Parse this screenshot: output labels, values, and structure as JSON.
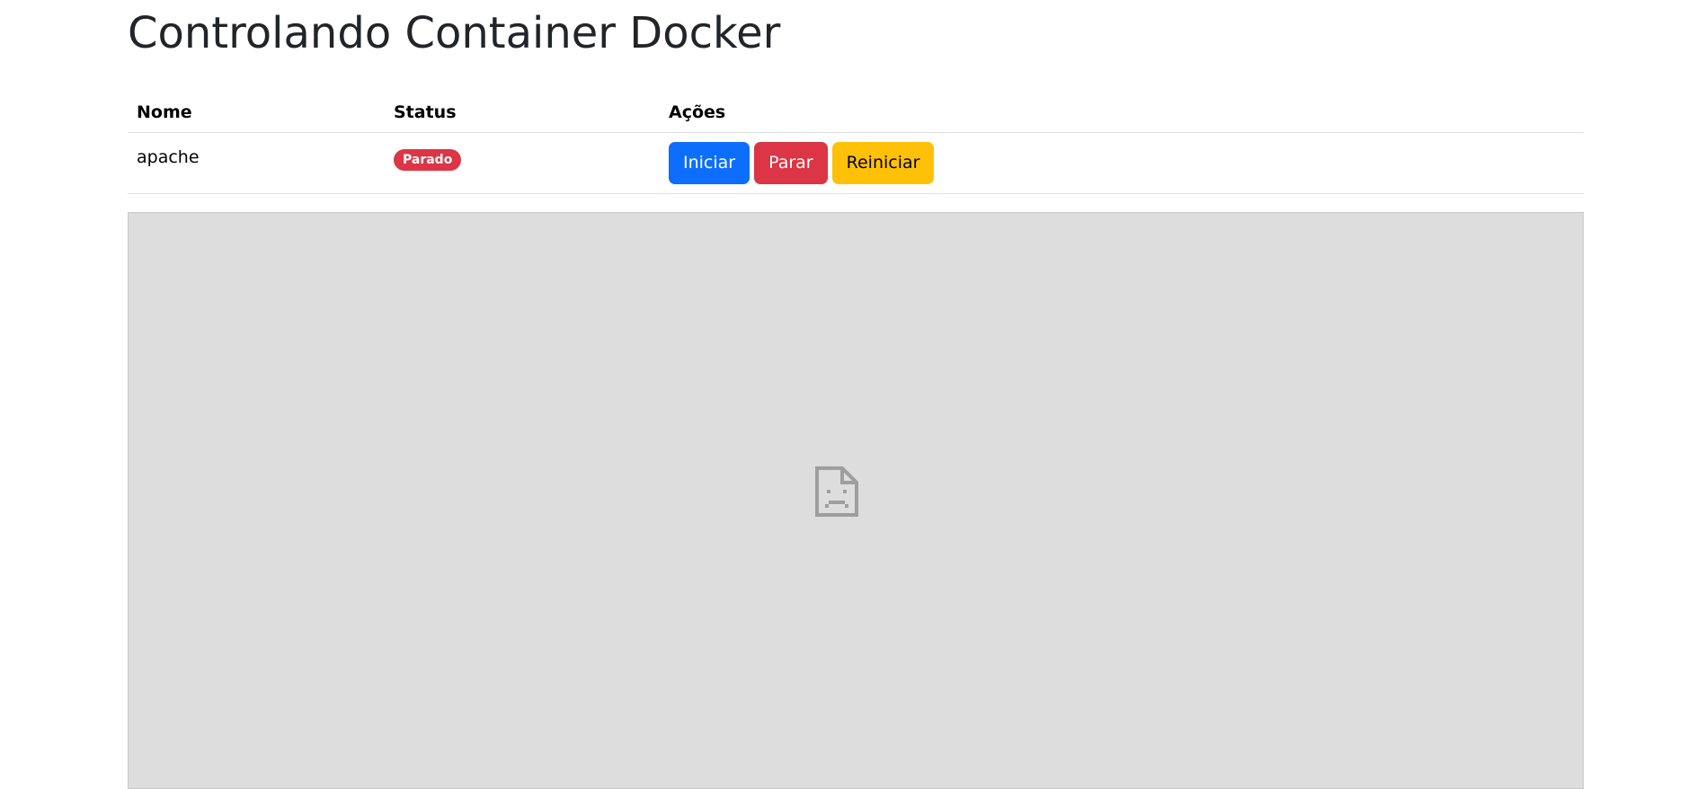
{
  "page": {
    "title": "Controlando Container Docker"
  },
  "table": {
    "headers": {
      "name": "Nome",
      "status": "Status",
      "actions": "Ações"
    },
    "rows": [
      {
        "name": "apache",
        "status": "Parado",
        "status_color": "#dc3545",
        "actions": {
          "start": "Iniciar",
          "stop": "Parar",
          "restart": "Reiniciar"
        }
      }
    ]
  },
  "frame": {
    "icon": "broken-page-icon",
    "background": "#dddddd"
  },
  "colors": {
    "primary": "#0d6efd",
    "danger": "#dc3545",
    "warning": "#ffc107"
  }
}
